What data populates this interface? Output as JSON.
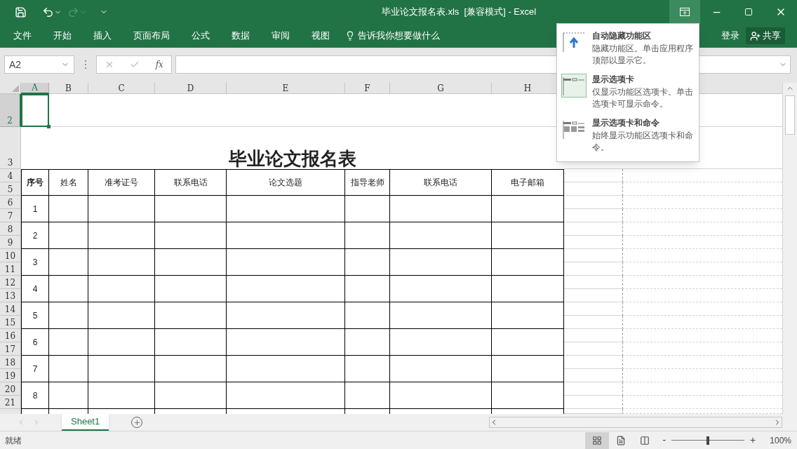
{
  "window": {
    "title": "毕业论文报名表.xls  [兼容模式] - Excel"
  },
  "ribbon_tabs": [
    {
      "label": "文件"
    },
    {
      "label": "开始"
    },
    {
      "label": "插入"
    },
    {
      "label": "页面布局"
    },
    {
      "label": "公式"
    },
    {
      "label": "数据"
    },
    {
      "label": "审阅"
    },
    {
      "label": "视图"
    }
  ],
  "tell_me": "告诉我你想要做什么",
  "sign_in": "登录",
  "share": "共享",
  "name_box": "A2",
  "fx": "fx",
  "column_headers": [
    {
      "label": "A",
      "selected": true
    },
    {
      "label": "B",
      "selected": false
    },
    {
      "label": "C",
      "selected": false
    },
    {
      "label": "D",
      "selected": false
    },
    {
      "label": "E",
      "selected": false
    },
    {
      "label": "F",
      "selected": false
    },
    {
      "label": "G",
      "selected": false
    },
    {
      "label": "H",
      "selected": false
    }
  ],
  "row_headers": [
    {
      "label": "2",
      "selected": true
    },
    {
      "label": "3",
      "selected": false
    },
    {
      "label": "4",
      "selected": false
    },
    {
      "label": "5",
      "selected": false
    },
    {
      "label": "6",
      "selected": false
    },
    {
      "label": "7",
      "selected": false
    },
    {
      "label": "8",
      "selected": false
    },
    {
      "label": "9",
      "selected": false
    },
    {
      "label": "10",
      "selected": false
    },
    {
      "label": "11",
      "selected": false
    },
    {
      "label": "12",
      "selected": false
    },
    {
      "label": "13",
      "selected": false
    },
    {
      "label": "14",
      "selected": false
    },
    {
      "label": "15",
      "selected": false
    },
    {
      "label": "16",
      "selected": false
    },
    {
      "label": "17",
      "selected": false
    },
    {
      "label": "18",
      "selected": false
    },
    {
      "label": "19",
      "selected": false
    },
    {
      "label": "20",
      "selected": false
    },
    {
      "label": "21",
      "selected": false
    }
  ],
  "sheet": {
    "title": "毕业论文报名表",
    "table_headers": [
      {
        "label": "序号",
        "bold": true
      },
      {
        "label": "姓名",
        "bold": false
      },
      {
        "label": "准考证号",
        "bold": false
      },
      {
        "label": "联系电话",
        "bold": false
      },
      {
        "label": "论文选题",
        "bold": false
      },
      {
        "label": "指导老师",
        "bold": false
      },
      {
        "label": "联系电话",
        "bold": false
      },
      {
        "label": "电子邮箱",
        "bold": false
      }
    ],
    "row_numbers": [
      "1",
      "2",
      "3",
      "4",
      "5",
      "6",
      "7",
      "8"
    ]
  },
  "ribbon_menu": [
    {
      "kind": "auto-hide",
      "title": "自动隐藏功能区",
      "description": "隐藏功能区。单击应用程序顶部以显示它。",
      "selected": false
    },
    {
      "kind": "tabs",
      "title": "显示选项卡",
      "description": "仅显示功能区选项卡。单击选项卡可显示命令。",
      "selected": true
    },
    {
      "kind": "tabs-commands",
      "title": "显示选项卡和命令",
      "description": "始终显示功能区选项卡和命令。",
      "selected": false
    }
  ],
  "sheet_tabs": [
    {
      "label": "Sheet1",
      "selected": true
    }
  ],
  "status_bar": {
    "text": "就绪",
    "views": [
      {
        "kind": "normal",
        "selected": true
      },
      {
        "kind": "page-layout",
        "selected": false
      },
      {
        "kind": "page-break",
        "selected": false
      }
    ],
    "zoom": {
      "minus": "-",
      "plus": "+",
      "level": 0.5,
      "reading": "100%"
    }
  }
}
